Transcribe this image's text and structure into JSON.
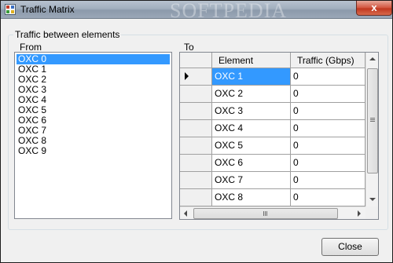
{
  "window": {
    "title": "Traffic Matrix",
    "watermark": "SOFTPEDIA",
    "close_glyph": "x"
  },
  "group": {
    "label": "Traffic between elements"
  },
  "from": {
    "label": "From",
    "items": [
      "OXC 0",
      "OXC 1",
      "OXC 2",
      "OXC 3",
      "OXC 4",
      "OXC 5",
      "OXC 6",
      "OXC 7",
      "OXC 8",
      "OXC 9"
    ],
    "selected": "OXC 0"
  },
  "to": {
    "label": "To",
    "columns": [
      "Element",
      "Traffic (Gbps)"
    ],
    "rows": [
      {
        "element": "OXC 1",
        "traffic": "0"
      },
      {
        "element": "OXC 2",
        "traffic": "0"
      },
      {
        "element": "OXC 3",
        "traffic": "0"
      },
      {
        "element": "OXC 4",
        "traffic": "0"
      },
      {
        "element": "OXC 5",
        "traffic": "0"
      },
      {
        "element": "OXC 6",
        "traffic": "0"
      },
      {
        "element": "OXC 7",
        "traffic": "0"
      },
      {
        "element": "OXC 8",
        "traffic": "0"
      }
    ]
  },
  "buttons": {
    "close_label": "Close"
  }
}
